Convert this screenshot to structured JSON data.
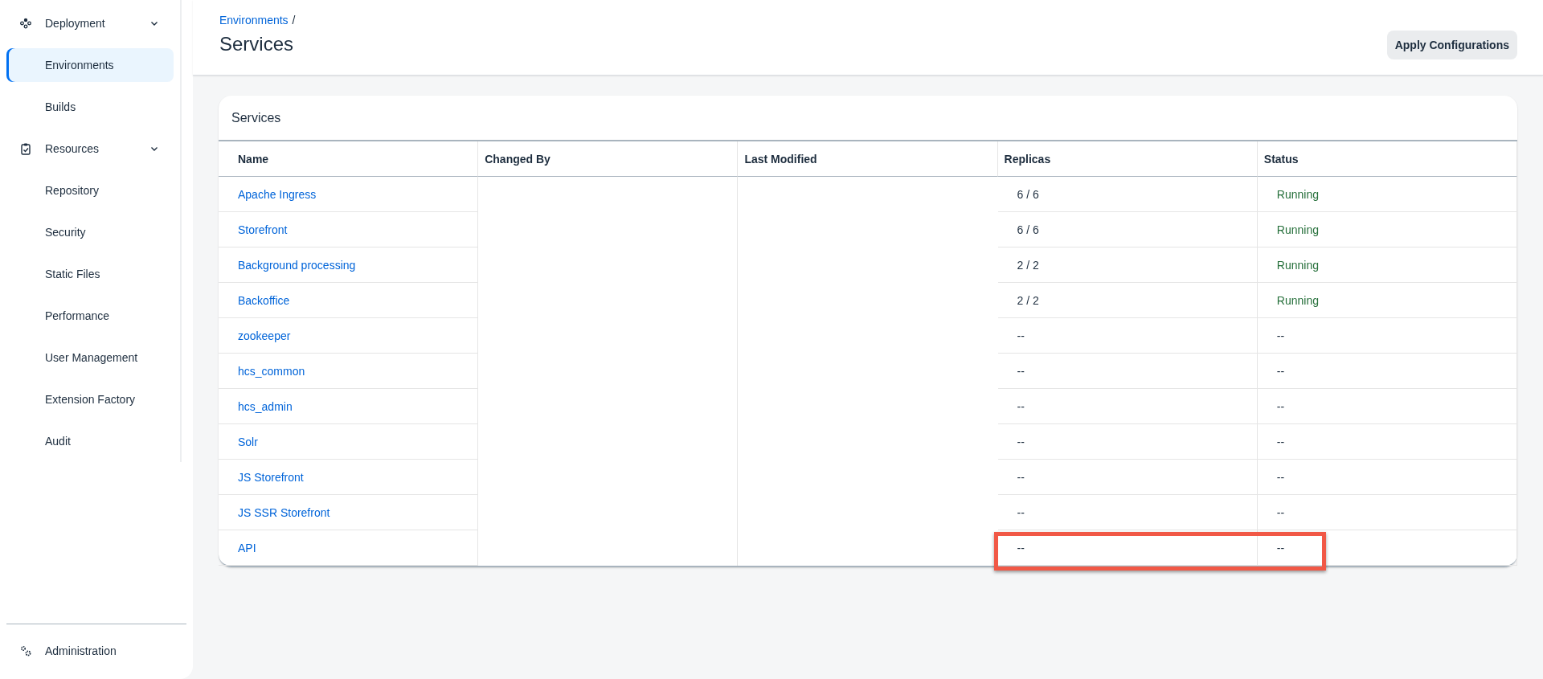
{
  "sidebar": {
    "groups": [
      {
        "label": "Deployment",
        "expanded": true,
        "items": [
          {
            "label": "Environments",
            "selected": true
          },
          {
            "label": "Builds",
            "selected": false
          }
        ]
      },
      {
        "label": "Resources",
        "expanded": true,
        "items": [
          {
            "label": "Repository",
            "selected": false
          },
          {
            "label": "Security",
            "selected": false
          },
          {
            "label": "Static Files",
            "selected": false
          },
          {
            "label": "Performance",
            "selected": false
          },
          {
            "label": "User Management",
            "selected": false
          },
          {
            "label": "Extension Factory",
            "selected": false
          },
          {
            "label": "Audit",
            "selected": false
          }
        ]
      }
    ],
    "footer": {
      "label": "Administration"
    }
  },
  "header": {
    "breadcrumb": "Environments",
    "separator": "/",
    "title": "Services",
    "action": "Apply Configurations"
  },
  "card": {
    "title": "Services",
    "columns": [
      "Name",
      "Changed By",
      "Last Modified",
      "Replicas",
      "Status"
    ],
    "rows": [
      {
        "name": "Apache Ingress",
        "replicas": "6 / 6",
        "status": "Running",
        "running": true,
        "highlighted": false
      },
      {
        "name": "Storefront",
        "replicas": "6 / 6",
        "status": "Running",
        "running": true,
        "highlighted": false
      },
      {
        "name": "Background processing",
        "replicas": "2 / 2",
        "status": "Running",
        "running": true,
        "highlighted": false
      },
      {
        "name": "Backoffice",
        "replicas": "2 / 2",
        "status": "Running",
        "running": true,
        "highlighted": false
      },
      {
        "name": "zookeeper",
        "replicas": "--",
        "status": "--",
        "running": false,
        "highlighted": false
      },
      {
        "name": "hcs_common",
        "replicas": "--",
        "status": "--",
        "running": false,
        "highlighted": false
      },
      {
        "name": "hcs_admin",
        "replicas": "--",
        "status": "--",
        "running": false,
        "highlighted": false
      },
      {
        "name": "Solr",
        "replicas": "--",
        "status": "--",
        "running": false,
        "highlighted": false
      },
      {
        "name": "JS Storefront",
        "replicas": "--",
        "status": "--",
        "running": false,
        "highlighted": false
      },
      {
        "name": "JS SSR Storefront",
        "replicas": "--",
        "status": "--",
        "running": false,
        "highlighted": false
      },
      {
        "name": "API",
        "replicas": "--",
        "status": "--",
        "running": false,
        "highlighted": true
      }
    ]
  }
}
